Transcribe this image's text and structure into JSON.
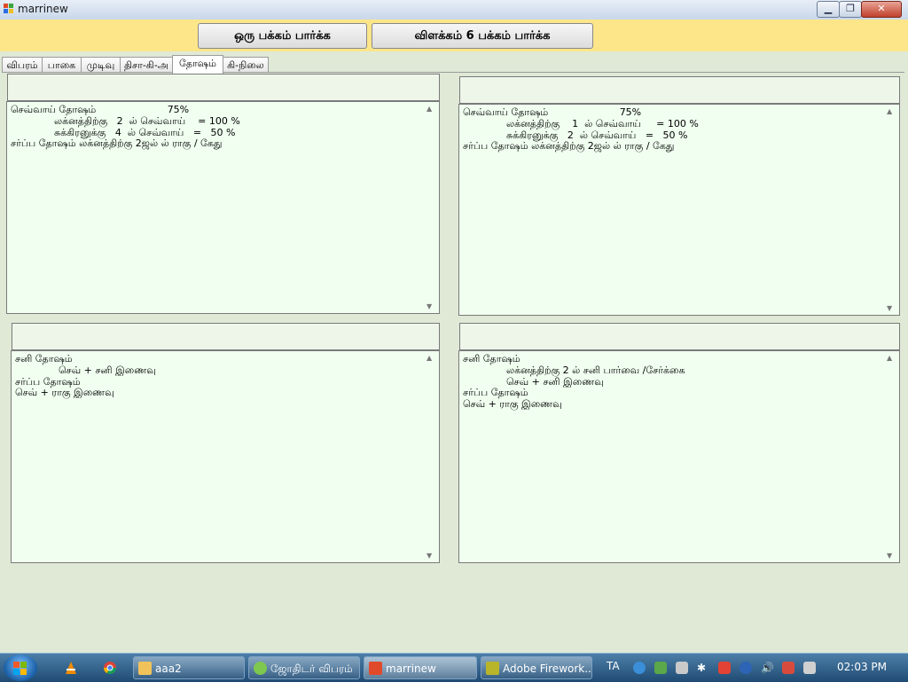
{
  "window": {
    "title": "marrinew",
    "min_label": "▁",
    "max_label": "❐",
    "close_label": "✕"
  },
  "toolbar": {
    "btn_one": "ஒரு பக்கம் பார்க்க",
    "btn_two": "விளக்கம் 6 பக்கம் பார்க்க"
  },
  "tabs": [
    {
      "label": "விபரம்"
    },
    {
      "label": "பாகை"
    },
    {
      "label": "முடிவு"
    },
    {
      "label": "திசா-கி-அ"
    },
    {
      "label": "தோஷம்"
    },
    {
      "label": "கி-நிலை"
    }
  ],
  "active_tab": "தோஷம்",
  "panels": {
    "top_left": {
      "header": "",
      "text": "செவ்வாய் தோஷம்                       75%\n              லக்னத்திற்கு   2  ல் செவ்வாய்    = 100 %\n              சுக்கிரனுக்கு   4  ல் செவ்வாய்   =   50 %\nசர்ப்ப தோஷம் லக்னத்திற்கு 2ஜல் ல் ராகு / கேது"
    },
    "top_right": {
      "header": "",
      "text": "செவ்வாய் தோஷம்                       75%\n              லக்னத்திற்கு    1  ல் செவ்வாய்     = 100 %\n              சுக்கிரனுக்கு   2  ல் செவ்வாய்   =   50 %\nசர்ப்ப தோஷம் லக்னத்திற்கு 2ஜல் ல் ராகு / கேது"
    },
    "bottom_left": {
      "header": "",
      "text": "சனி தோஷம்\n              செவ் + சனி இணைவு\nசர்ப்ப தோஷம்\nசெவ் + ராகு இணைவு"
    },
    "bottom_right": {
      "header": "",
      "text": "சனி தோஷம்\n              லக்னத்திற்கு 2 ல் சனி பார்வை /சேர்க்கை\n              செவ் + சனி இணைவு\nசர்ப்ப தோஷம்\nசெவ் + ராகு இணைவு"
    }
  },
  "taskbar": {
    "items": [
      {
        "label": "aaa2"
      },
      {
        "label": "ஜோதிடர் விபரம்"
      },
      {
        "label": "marrinew"
      },
      {
        "label": "Adobe Firework..."
      }
    ],
    "language": "TA",
    "clock": "02:03 PM"
  },
  "colors": {
    "toolbar_bg": "#fde68a",
    "text_bg": "#f0fff0",
    "header_bg": "#eef6ea",
    "body_bg": "#dfe9d6"
  }
}
